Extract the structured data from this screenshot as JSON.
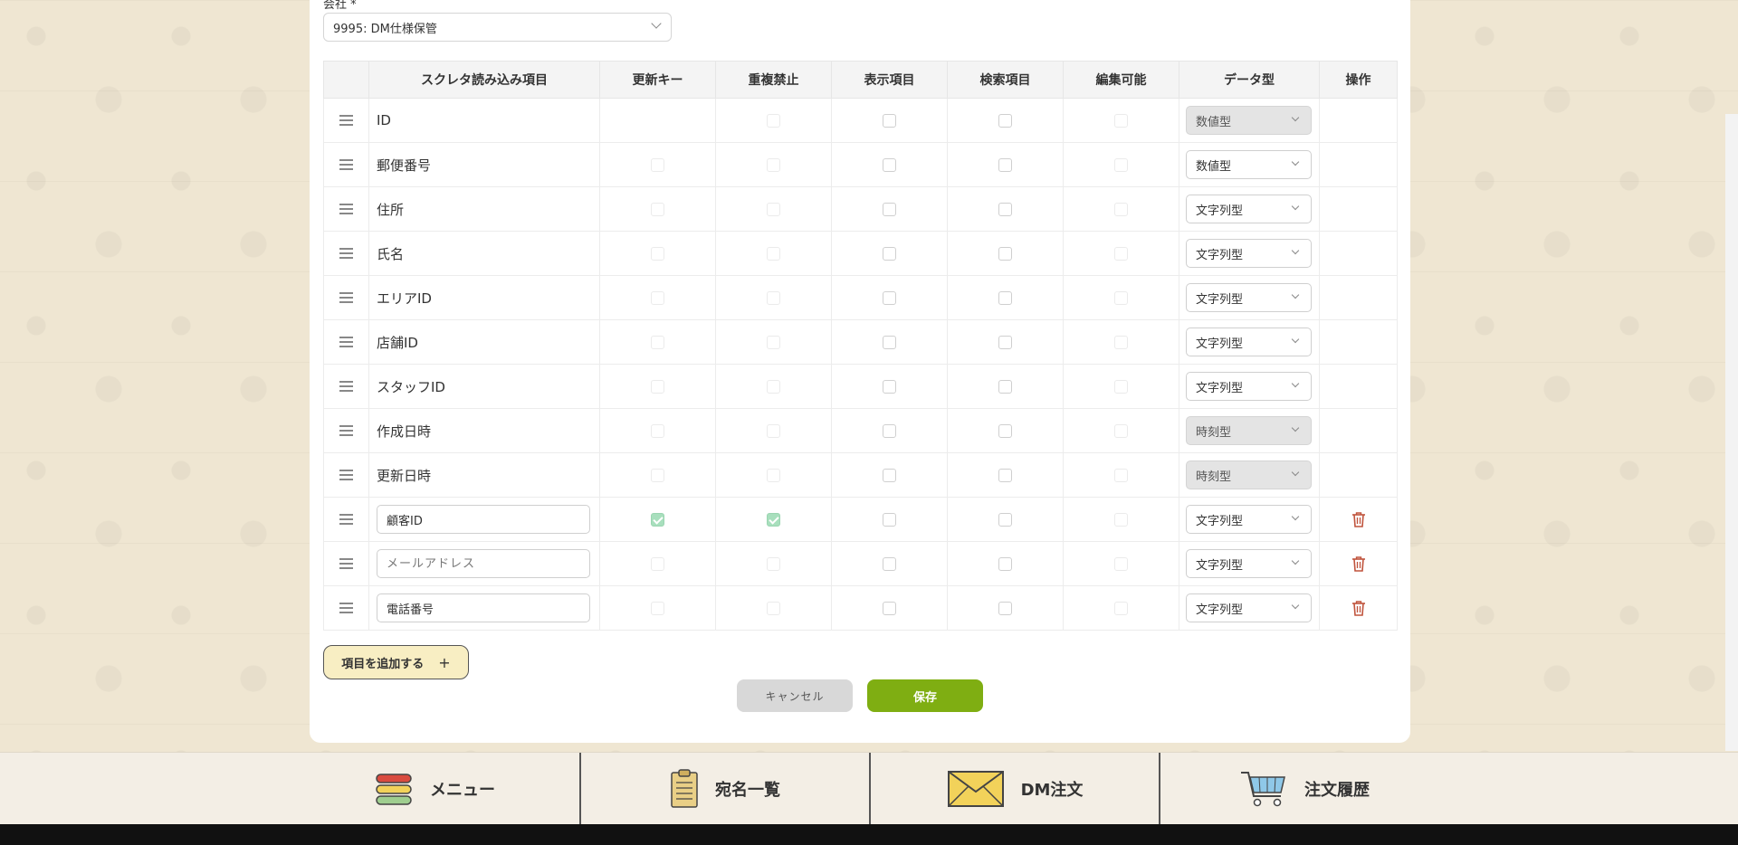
{
  "company": {
    "label": "会社 *",
    "selected": "9995: DM仕様保管"
  },
  "table": {
    "headers": {
      "name": "スクレタ読み込み項目",
      "update_key": "更新キー",
      "no_duplicate": "重複禁止",
      "display": "表示項目",
      "search": "検索項目",
      "editable": "編集可能",
      "data_type": "データ型",
      "operation": "操作"
    },
    "rows": [
      {
        "name": "ID",
        "type": "数値型"
      },
      {
        "name": "郵便番号",
        "type": "数値型"
      },
      {
        "name": "住所",
        "type": "文字列型"
      },
      {
        "name": "氏名",
        "type": "文字列型"
      },
      {
        "name": "エリアID",
        "type": "文字列型"
      },
      {
        "name": "店舗ID",
        "type": "文字列型"
      },
      {
        "name": "スタッフID",
        "type": "文字列型"
      },
      {
        "name": "作成日時",
        "type": "時刻型"
      },
      {
        "name": "更新日時",
        "type": "時刻型"
      },
      {
        "name": "顧客ID",
        "type": "文字列型",
        "update_key": true,
        "no_duplicate": true
      },
      {
        "name": "",
        "placeholder": "メールアドレス",
        "type": "文字列型"
      },
      {
        "name": "電話番号",
        "type": "文字列型"
      }
    ]
  },
  "actions": {
    "add_item": "項目を追加する",
    "add_plus": "+",
    "cancel": "キャンセル",
    "save": "保存"
  },
  "nav": {
    "menu": "メニュー",
    "address_list": "宛名一覧",
    "dm_order": "DM注文",
    "order_history": "注文履歴"
  },
  "colors": {
    "background": "#efe6d2",
    "save_green": "#7fae12",
    "check_green": "#a8dfbd",
    "add_button_bg": "#f8eec3",
    "trash_red": "#c0533c"
  }
}
